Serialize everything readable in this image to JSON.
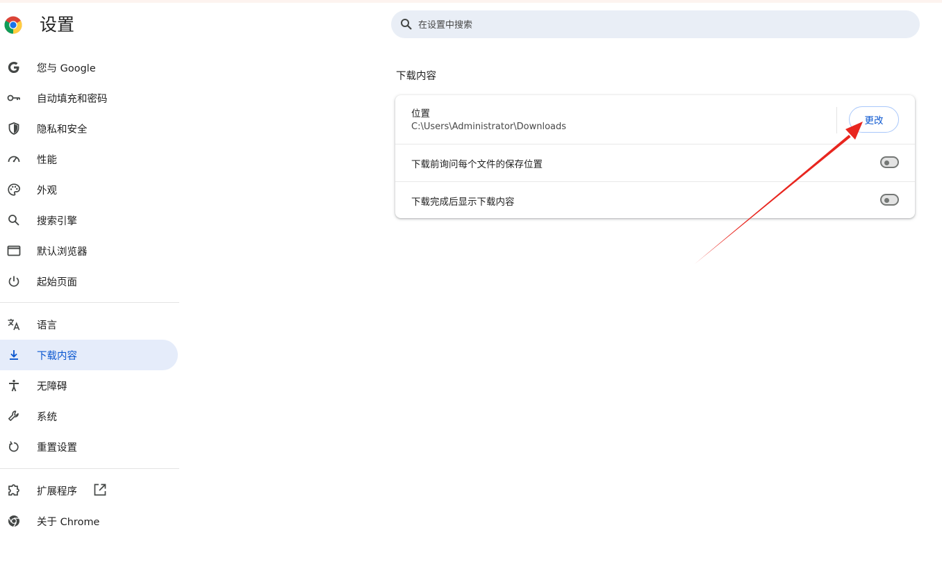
{
  "app": {
    "title": "设置"
  },
  "search": {
    "placeholder": "在设置中搜索"
  },
  "sidebar": {
    "items": [
      {
        "label": "您与 Google",
        "icon": "google-g-icon"
      },
      {
        "label": "自动填充和密码",
        "icon": "key-icon"
      },
      {
        "label": "隐私和安全",
        "icon": "shield-icon"
      },
      {
        "label": "性能",
        "icon": "speedometer-icon"
      },
      {
        "label": "外观",
        "icon": "palette-icon"
      },
      {
        "label": "搜索引擎",
        "icon": "search-icon"
      },
      {
        "label": "默认浏览器",
        "icon": "browser-window-icon"
      },
      {
        "label": "起始页面",
        "icon": "power-icon"
      },
      {
        "label": "语言",
        "icon": "translate-icon"
      },
      {
        "label": "下载内容",
        "icon": "download-icon",
        "active": true
      },
      {
        "label": "无障碍",
        "icon": "accessibility-icon"
      },
      {
        "label": "系统",
        "icon": "wrench-icon"
      },
      {
        "label": "重置设置",
        "icon": "reset-icon"
      },
      {
        "label": "扩展程序",
        "icon": "puzzle-icon"
      },
      {
        "label": "关于 Chrome",
        "icon": "chrome-icon"
      }
    ]
  },
  "downloads": {
    "section_title": "下载内容",
    "location_label": "位置",
    "location_path": "C:\\Users\\Administrator\\Downloads",
    "change_button": "更改",
    "ask_where_label": "下载前询问每个文件的保存位置",
    "ask_where_enabled": false,
    "show_when_done_label": "下载完成后显示下载内容",
    "show_when_done_enabled": false
  },
  "colors": {
    "accent": "#0b57d0",
    "active_nav_bg": "#e5ecfa",
    "search_bg": "#e9eef6",
    "annotation_arrow": "#e8261f"
  }
}
